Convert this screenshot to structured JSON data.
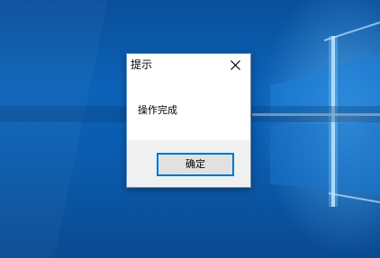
{
  "dialog": {
    "title": "提示",
    "message": "操作完成",
    "ok_label": "确定"
  },
  "colors": {
    "desktop_blue": "#0b63b8",
    "accent": "#0078d7",
    "footer_bg": "#f0f0f0"
  },
  "icons": {
    "close": "close-icon"
  }
}
